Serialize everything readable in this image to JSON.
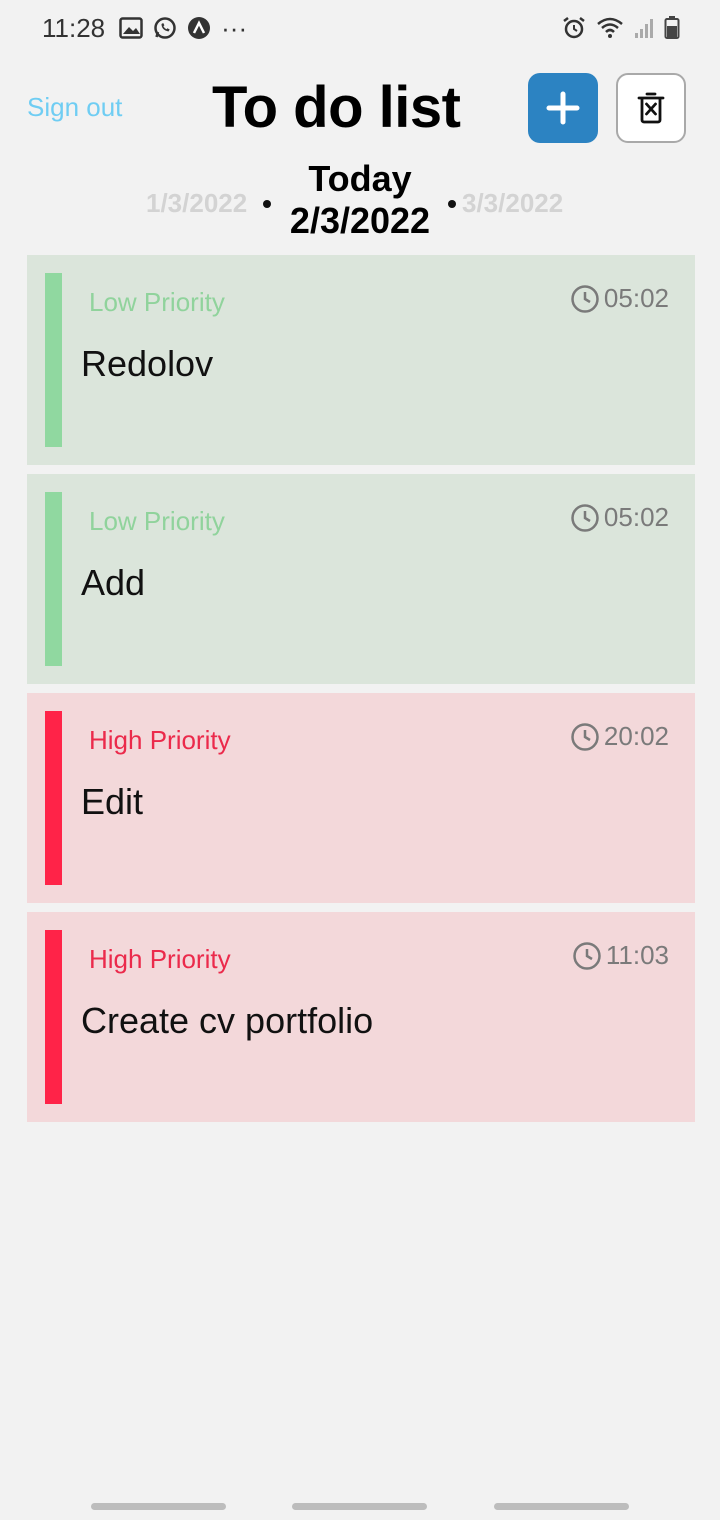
{
  "status_bar": {
    "time": "11:28",
    "more": "···"
  },
  "header": {
    "sign_out": "Sign out",
    "title": "To do list"
  },
  "date_nav": {
    "prev": "1/3/2022",
    "today_label": "Today",
    "current": "2/3/2022",
    "next": "3/3/2022"
  },
  "tasks": [
    {
      "priority": "Low Priority",
      "time": "05:02",
      "name": "Redolov",
      "level": "low"
    },
    {
      "priority": "Low Priority",
      "time": "05:02",
      "name": "Add",
      "level": "low"
    },
    {
      "priority": "High Priority",
      "time": "20:02",
      "name": "Edit",
      "level": "high"
    },
    {
      "priority": "High Priority",
      "time": "11:03",
      "name": "Create cv portfolio",
      "level": "high"
    }
  ],
  "colors": {
    "low_accent": "#90d8a0",
    "high_accent": "#ff2348",
    "add_button": "#2c83c2",
    "sign_out": "#6fcdf3"
  }
}
